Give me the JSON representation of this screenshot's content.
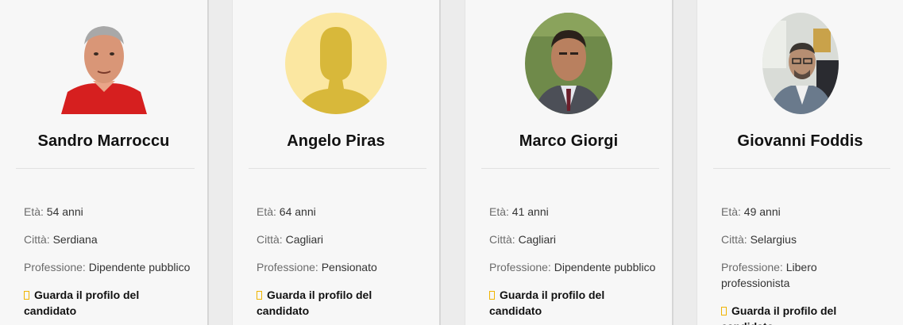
{
  "candidates": [
    {
      "name": "Sandro Marroccu",
      "age_label": "Età:",
      "age_value": "54 anni",
      "city_label": "Città:",
      "city_value": "Serdiana",
      "job_label": "Professione:",
      "job_value": "Dipendente pubblico",
      "profile_link": "Guarda il profilo del candidato"
    },
    {
      "name": "Angelo Piras",
      "age_label": "Età:",
      "age_value": "64 anni",
      "city_label": "Città:",
      "city_value": "Cagliari",
      "job_label": "Professione:",
      "job_value": "Pensionato",
      "profile_link": "Guarda il profilo del candidato"
    },
    {
      "name": "Marco Giorgi",
      "age_label": "Età:",
      "age_value": "41 anni",
      "city_label": "Città:",
      "city_value": "Cagliari",
      "job_label": "Professione:",
      "job_value": "Dipendente pubblico",
      "profile_link": "Guarda il profilo del candidato"
    },
    {
      "name": "Giovanni Foddis",
      "age_label": "Età:",
      "age_value": "49 anni",
      "city_label": "Città:",
      "city_value": "Selargius",
      "job_label": "Professione:",
      "job_value": "Libero professionista",
      "profile_link": "Guarda il profilo del candidato"
    }
  ],
  "colors": {
    "accent": "#f0b400",
    "placeholder_bg": "#fbe7a1",
    "placeholder_fg": "#d8b83a"
  }
}
